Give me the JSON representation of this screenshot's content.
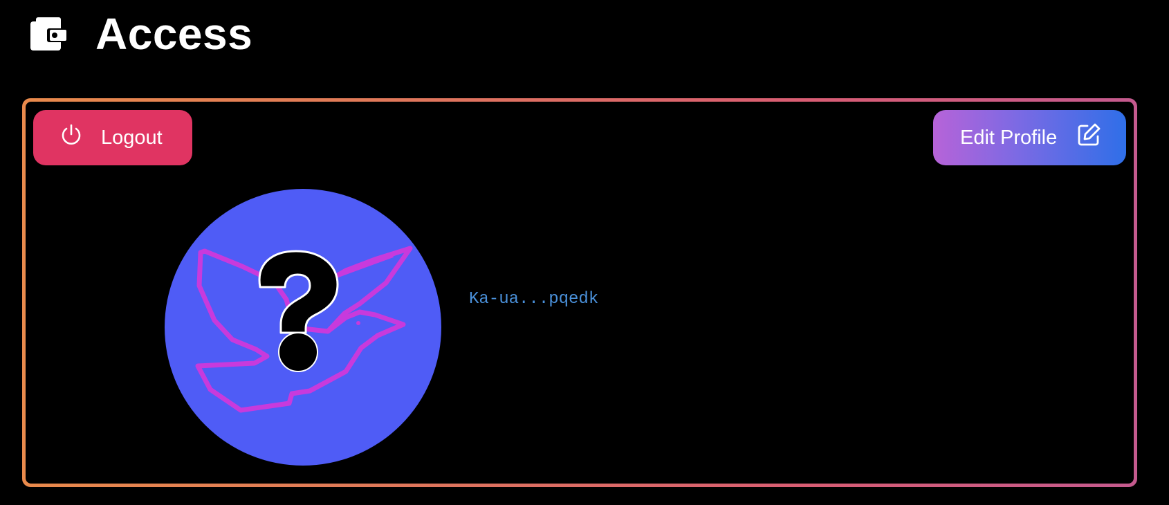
{
  "header": {
    "title": "Access",
    "icon": "wallet-icon"
  },
  "profile_card": {
    "logout_label": "Logout",
    "logout_icon": "power-icon",
    "edit_label": "Edit Profile",
    "edit_icon": "edit-icon",
    "avatar_icon": "question-dove-icon",
    "address": "Ka-ua...pqedk"
  },
  "colors": {
    "background": "#000000",
    "logout_button": "#e03462",
    "edit_button_start": "#b763d8",
    "edit_button_end": "#2f6fe8",
    "avatar_bg": "#4f5cf6",
    "address_text": "#4a90d9",
    "border_start": "#e98a4c",
    "border_end": "#c45a8e"
  }
}
